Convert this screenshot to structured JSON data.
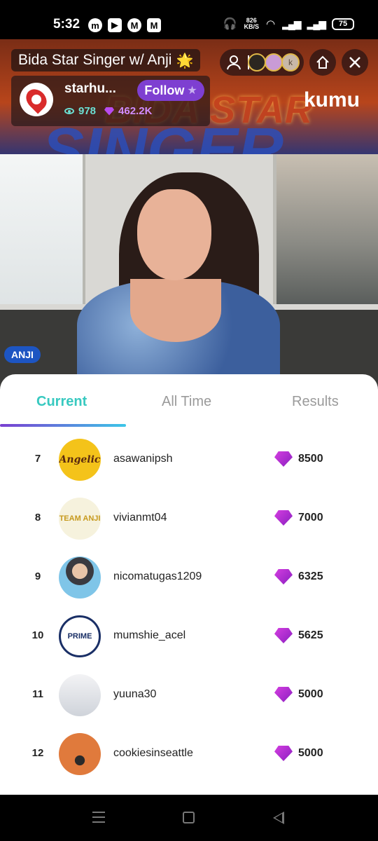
{
  "status_bar": {
    "time": "5:32",
    "net_speed_value": "826",
    "net_speed_unit": "KB/S",
    "battery": "75",
    "app_icons": [
      "messenger-icon",
      "youtube-icon",
      "vpn-icon",
      "gmail-icon"
    ]
  },
  "stream": {
    "title": "Bida Star Singer w/ Anji",
    "title_emoji": "🌟",
    "banner_text": "BIDA STAR",
    "banner_text_2": "SINGER",
    "brand": "kumu",
    "host": {
      "name": "starhu...",
      "follow_label": "Follow",
      "viewers": "978",
      "diamonds": "462.2K"
    },
    "mini_avatar_initial": "k",
    "performer_tag": "ANJI"
  },
  "tabs": [
    {
      "label": "Current",
      "active": true
    },
    {
      "label": "All Time",
      "active": false
    },
    {
      "label": "Results",
      "active": false
    }
  ],
  "leaderboard": [
    {
      "rank": "7",
      "username": "asawanipsh",
      "score": "8500",
      "avatar_text": "Angelic"
    },
    {
      "rank": "8",
      "username": "vivianmt04",
      "score": "7000",
      "avatar_text": "TEAM ANJI"
    },
    {
      "rank": "9",
      "username": "nicomatugas1209",
      "score": "6325",
      "avatar_text": ""
    },
    {
      "rank": "10",
      "username": "mumshie_acel",
      "score": "5625",
      "avatar_text": "PRIME"
    },
    {
      "rank": "11",
      "username": "yuuna30",
      "score": "5000",
      "avatar_text": ""
    },
    {
      "rank": "12",
      "username": "cookiesinseattle",
      "score": "5000",
      "avatar_text": ""
    }
  ],
  "colors": {
    "accent_teal": "#38c9c0",
    "follow_purple": "#7e3fd1",
    "diamond": "#b84bf0",
    "tag_blue": "#1d55c2"
  }
}
